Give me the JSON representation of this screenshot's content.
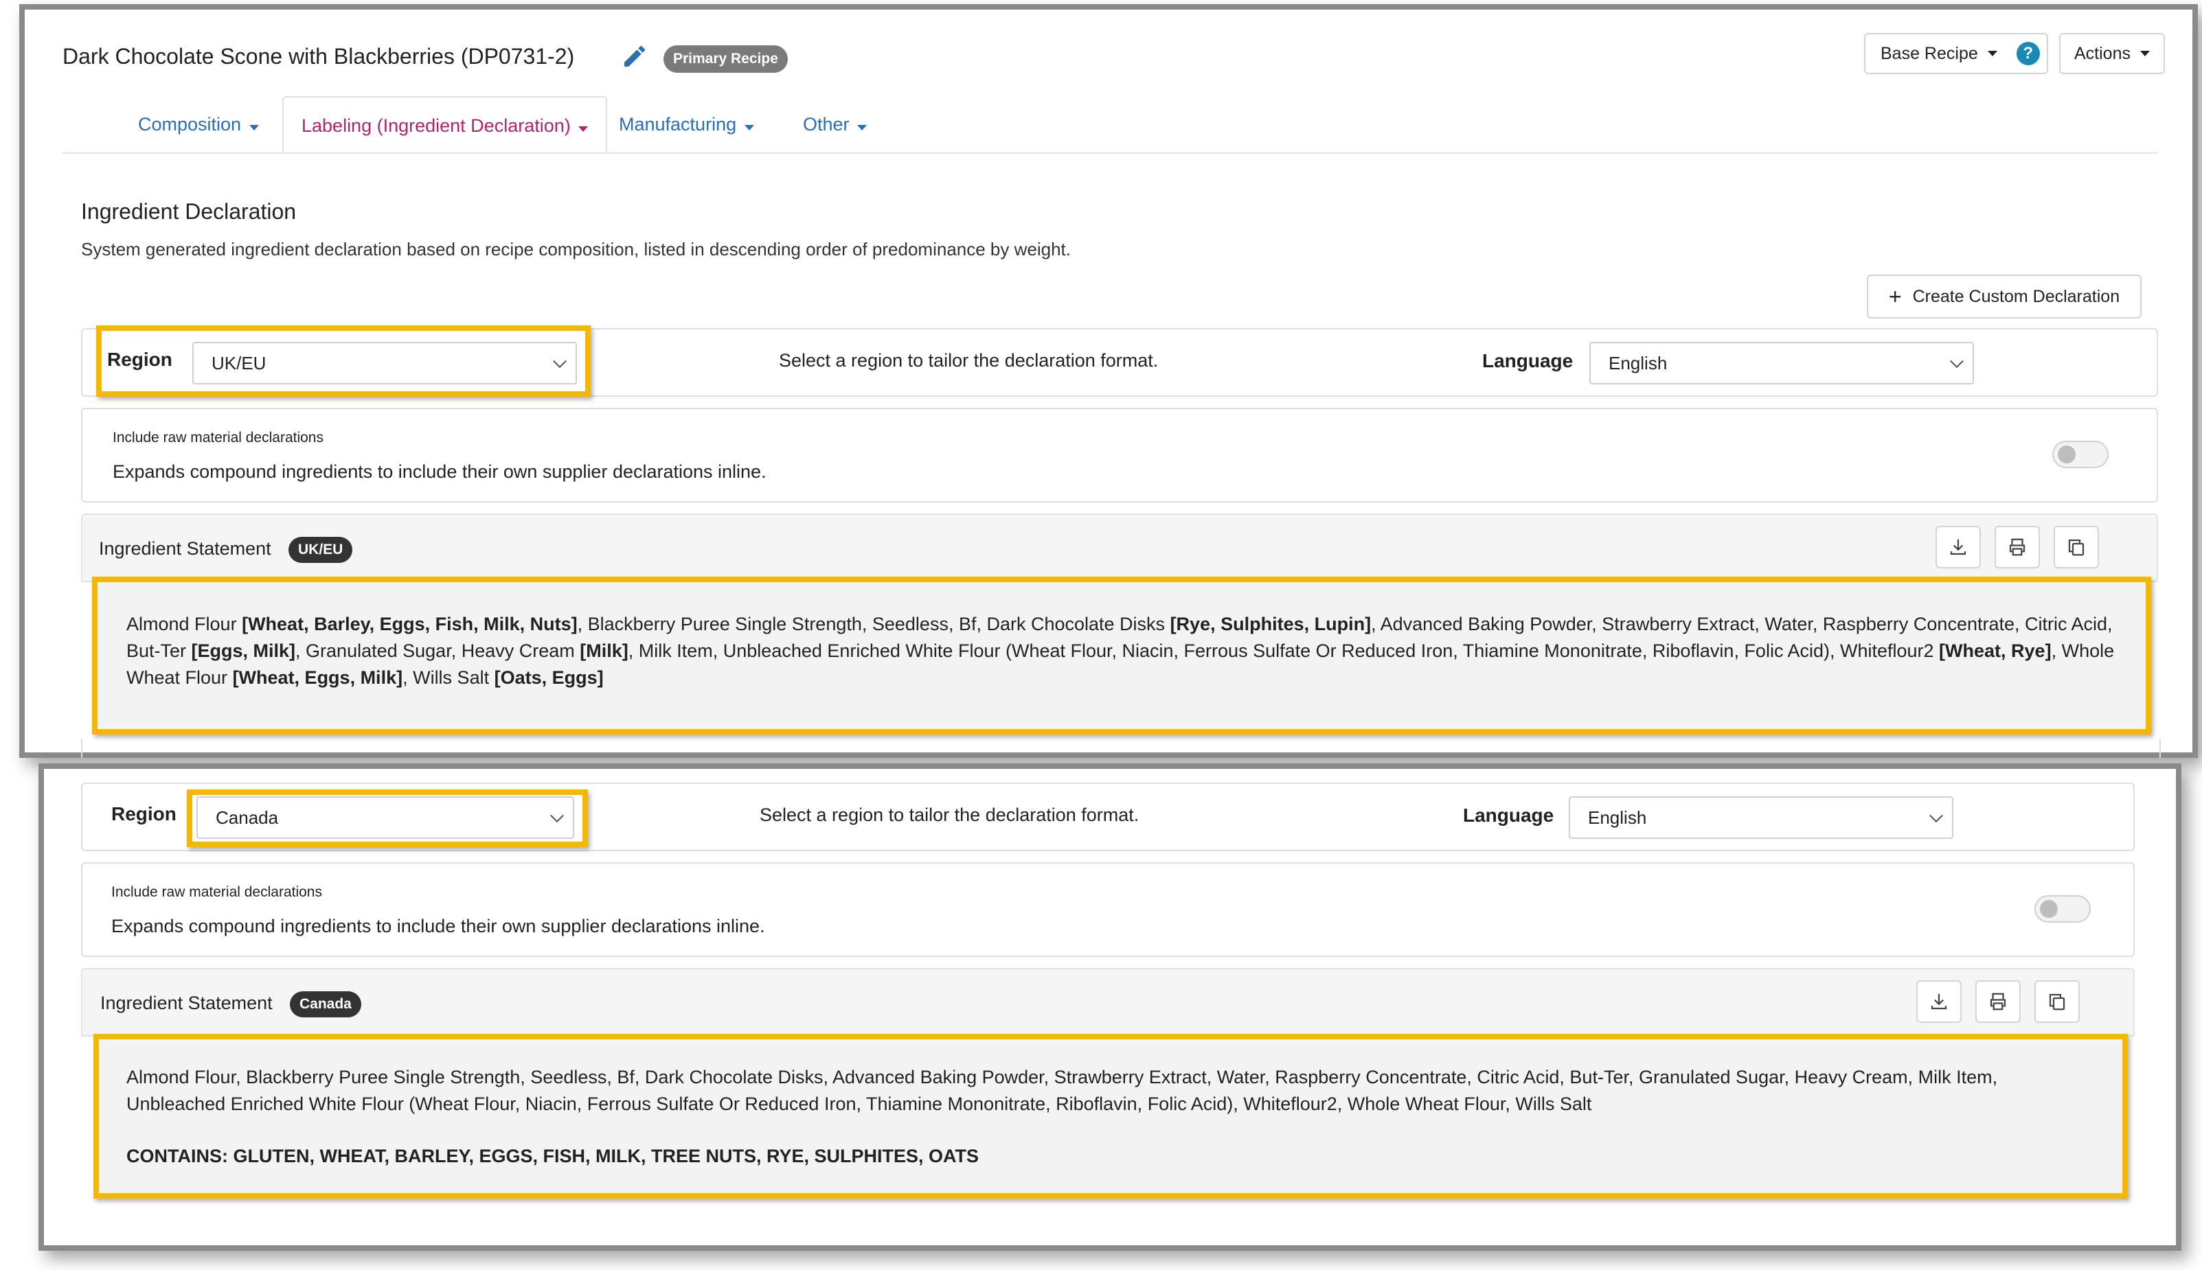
{
  "header": {
    "title": "Dark Chocolate Scone with Blackberries (DP0731-2)",
    "primary_badge": "Primary Recipe",
    "base_recipe_label": "Base Recipe",
    "help_glyph": "?",
    "actions_label": "Actions"
  },
  "tabs": [
    {
      "label": "Composition",
      "active": false
    },
    {
      "label": "Labeling (Ingredient Declaration)",
      "active": true
    },
    {
      "label": "Manufacturing",
      "active": false
    },
    {
      "label": "Other",
      "active": false
    }
  ],
  "section": {
    "title": "Ingredient Declaration",
    "description": "System generated ingredient declaration based on recipe composition, listed in descending order of predominance by weight.",
    "create_button": "Create Custom Declaration",
    "create_icon": "+"
  },
  "controls": {
    "region_label": "Region",
    "region_hint": "Select a region to tailor the declaration format.",
    "language_label": "Language",
    "language_value": "English",
    "raw_caption": "Include raw material declarations",
    "raw_desc": "Expands compound ingredients to include their own supplier declarations inline.",
    "raw_toggle_on": false,
    "statement_label": "Ingredient Statement"
  },
  "top": {
    "region_value": "UK/EU",
    "badge": "UK/EU",
    "statement_segments": [
      {
        "t": "Almond Flour ",
        "b": false
      },
      {
        "t": "[Wheat, Barley, Eggs, Fish, Milk, Nuts]",
        "b": true
      },
      {
        "t": ", Blackberry Puree Single Strength, Seedless, Bf, Dark Chocolate Disks ",
        "b": false
      },
      {
        "t": "[Rye, Sulphites, Lupin]",
        "b": true
      },
      {
        "t": ", Advanced Baking Powder, Strawberry Extract, Water, Raspberry Concentrate, Citric Acid, But-Ter ",
        "b": false
      },
      {
        "t": "[Eggs, Milk]",
        "b": true
      },
      {
        "t": ", Granulated Sugar, Heavy Cream ",
        "b": false
      },
      {
        "t": "[Milk]",
        "b": true
      },
      {
        "t": ", Milk Item, Unbleached Enriched White Flour (Wheat Flour, Niacin, Ferrous Sulfate Or Reduced Iron, Thiamine Mononitrate, Riboflavin, Folic Acid), Whiteflour2 ",
        "b": false
      },
      {
        "t": "[Wheat, Rye]",
        "b": true
      },
      {
        "t": ", Whole Wheat Flour ",
        "b": false
      },
      {
        "t": "[Wheat, Eggs, Milk]",
        "b": true
      },
      {
        "t": ", Wills Salt ",
        "b": false
      },
      {
        "t": "[Oats, Eggs]",
        "b": true
      }
    ]
  },
  "bottom": {
    "region_value": "Canada",
    "badge": "Canada",
    "statement_text": "Almond Flour, Blackberry Puree Single Strength, Seedless, Bf, Dark Chocolate Disks, Advanced Baking Powder, Strawberry Extract, Water, Raspberry Concentrate, Citric Acid, But-Ter, Granulated Sugar, Heavy Cream, Milk Item, Unbleached Enriched White Flour (Wheat Flour, Niacin, Ferrous Sulfate Or Reduced Iron, Thiamine Mononitrate, Riboflavin, Folic Acid), Whiteflour2, Whole Wheat Flour, Wills Salt",
    "contains_text": "CONTAINS: GLUTEN, WHEAT, BARLEY, EGGS, FISH, MILK, TREE NUTS, RYE, SULPHITES, OATS"
  },
  "icons": {
    "edit": "pencil-icon",
    "download": "download-icon",
    "print": "print-icon",
    "copy": "copy-icon",
    "help": "help-icon"
  },
  "colors": {
    "highlight": "#f5b800",
    "active_tab": "#b0246e",
    "link": "#2a6fb3",
    "help": "#1a8ab5"
  }
}
